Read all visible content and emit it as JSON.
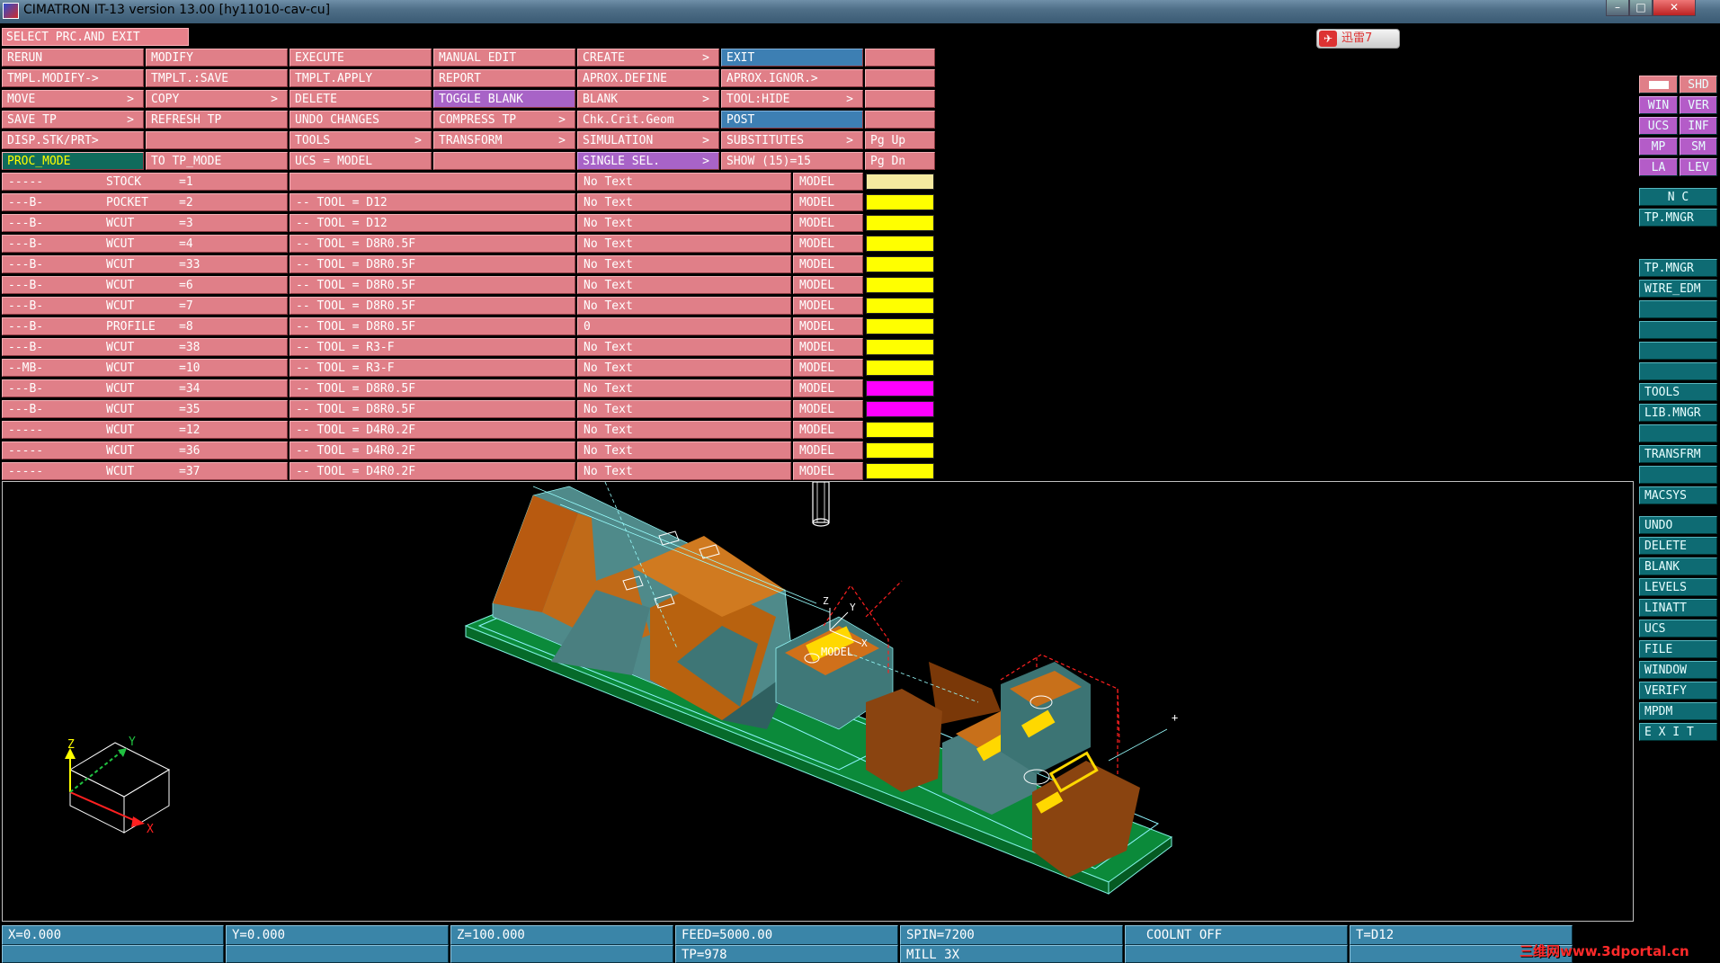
{
  "window": {
    "title": "CIMATRON IT-13 version 13.00 [hy11010-cav-cu]",
    "close_label": "✕"
  },
  "header": {
    "select_label": "SELECT PRC.AND EXIT"
  },
  "tray": {
    "xunlei_label": "迅雷7",
    "xunlei_icon": "✈"
  },
  "menu": {
    "rerun": "RERUN",
    "modify": "MODIFY",
    "execute": "EXECUTE",
    "manual_edit": "MANUAL EDIT",
    "create": "CREATE",
    "exit": "EXIT",
    "tmpl_modify": "TMPL.MODIFY->",
    "tmplt_save": "TMPLT.:SAVE",
    "tmplt_apply": "TMPLT.APPLY",
    "report": "REPORT",
    "aprox_define": "APROX.DEFINE",
    "aprox_ignor": "APROX.IGNOR.>",
    "move": "MOVE",
    "copy": "COPY",
    "delete": "DELETE",
    "toggle_blank": "TOGGLE BLANK",
    "blank": "BLANK",
    "tool_hide": "TOOL:HIDE",
    "save_tp": "SAVE TP",
    "refresh_tp": "REFRESH TP",
    "undo_changes": "UNDO CHANGES",
    "compress_tp": "COMPRESS TP",
    "chk_crit_geom": "Chk.Crit.Geom",
    "post": "POST",
    "disp_stk_prt": "DISP.STK/PRT>",
    "tools": "TOOLS",
    "transform": "TRANSFORM",
    "simulation": "SIMULATION",
    "substitutes": "SUBSTITUTES",
    "pg_up": "Pg Up",
    "proc_mode": "PROC_MODE",
    "to_tp_mode": "TO TP_MODE",
    "ucs_model": "UCS = MODEL",
    "single_sel": "SINGLE SEL.",
    "show": "SHOW (15)=15",
    "pg_dn": "Pg Dn",
    "arrow": ">"
  },
  "procedures": [
    {
      "flags": "-----",
      "name": "STOCK",
      "num": "=1",
      "tool": "",
      "text": "No Text",
      "model": "MODEL",
      "color": "#f5eaa0"
    },
    {
      "flags": "---B-",
      "name": "POCKET",
      "num": "=2",
      "tool": "-- TOOL = D12",
      "text": "No Text",
      "model": "MODEL",
      "color": "#ffff00"
    },
    {
      "flags": "---B-",
      "name": "WCUT",
      "num": "=3",
      "tool": "-- TOOL = D12",
      "text": "No Text",
      "model": "MODEL",
      "color": "#ffff00"
    },
    {
      "flags": "---B-",
      "name": "WCUT",
      "num": "=4",
      "tool": "-- TOOL = D8R0.5F",
      "text": "No Text",
      "model": "MODEL",
      "color": "#ffff00"
    },
    {
      "flags": "---B-",
      "name": "WCUT",
      "num": "=33",
      "tool": "-- TOOL = D8R0.5F",
      "text": "No Text",
      "model": "MODEL",
      "color": "#ffff00"
    },
    {
      "flags": "---B-",
      "name": "WCUT",
      "num": "=6",
      "tool": "-- TOOL = D8R0.5F",
      "text": "No Text",
      "model": "MODEL",
      "color": "#ffff00"
    },
    {
      "flags": "---B-",
      "name": "WCUT",
      "num": "=7",
      "tool": "-- TOOL = D8R0.5F",
      "text": "No Text",
      "model": "MODEL",
      "color": "#ffff00"
    },
    {
      "flags": "---B-",
      "name": "PROFILE",
      "num": "=8",
      "tool": "-- TOOL = D8R0.5F",
      "text": "0",
      "model": "MODEL",
      "color": "#ffff00"
    },
    {
      "flags": "---B-",
      "name": "WCUT",
      "num": "=38",
      "tool": "-- TOOL = R3-F",
      "text": "No Text",
      "model": "MODEL",
      "color": "#ffff00"
    },
    {
      "flags": "--MB-",
      "name": "WCUT",
      "num": "=10",
      "tool": "-- TOOL = R3-F",
      "text": "No Text",
      "model": "MODEL",
      "color": "#ffff00"
    },
    {
      "flags": "---B-",
      "name": "WCUT",
      "num": "=34",
      "tool": "-- TOOL = D8R0.5F",
      "text": "No Text",
      "model": "MODEL",
      "color": "#ff00ff"
    },
    {
      "flags": "---B-",
      "name": "WCUT",
      "num": "=35",
      "tool": "-- TOOL = D8R0.5F",
      "text": "No Text",
      "model": "MODEL",
      "color": "#ff00ff"
    },
    {
      "flags": "-----",
      "name": "WCUT",
      "num": "=12",
      "tool": "-- TOOL = D4R0.2F",
      "text": "No Text",
      "model": "MODEL",
      "color": "#ffff00"
    },
    {
      "flags": "-----",
      "name": "WCUT",
      "num": "=36",
      "tool": "-- TOOL = D4R0.2F",
      "text": "No Text",
      "model": "MODEL",
      "color": "#ffff00"
    },
    {
      "flags": "-----",
      "name": "WCUT",
      "num": "=37",
      "tool": "-- TOOL = D4R0.2F",
      "text": "No Text",
      "model": "MODEL",
      "color": "#ffff00"
    }
  ],
  "right_panel": {
    "shd": "SHD",
    "win": "WIN",
    "ver": "VER",
    "ucs": "UCS",
    "inf": "INF",
    "mp": "MP",
    "sm": "SM",
    "la": "LA",
    "lev": "LEV",
    "nc": "N C",
    "tp_mngr_1": "TP.MNGR",
    "tp_mngr_2": "TP.MNGR",
    "wire_edm": "WIRE_EDM",
    "tools": "TOOLS",
    "lib_mngr": "LIB.MNGR",
    "transfrm": "TRANSFRM",
    "macsys": "MACSYS",
    "undo": "UNDO",
    "delete": "DELETE",
    "blank": "BLANK",
    "levels": "LEVELS",
    "linatt": "LINATT",
    "ucs2": "UCS",
    "file": "FILE",
    "window": "WINDOW",
    "verify": "VERIFY",
    "mpdm": "MPDM",
    "exit": "E X I T"
  },
  "viewport": {
    "model_label": "MODEL",
    "axis_z": "Z",
    "axis_y": "Y",
    "axis_x": "X",
    "cross": "+"
  },
  "status": {
    "x": "X=0.000",
    "y": "Y=0.000",
    "z": "Z=100.000",
    "feed": "FEED=5000.00",
    "spin": "SPIN=7200",
    "coolant": "  COOLNT OFF",
    "tool": "T=D12",
    "tp": "TP=978",
    "mill": "MILL 3X"
  },
  "watermark": "三维网www.3dportal.cn",
  "colors": {
    "menu_pink": "#e07f88",
    "menu_blue": "#3d7fb3",
    "menu_violet": "#a863c7",
    "panel_teal": "#0e6b73",
    "status_blue": "#3a85a8"
  }
}
